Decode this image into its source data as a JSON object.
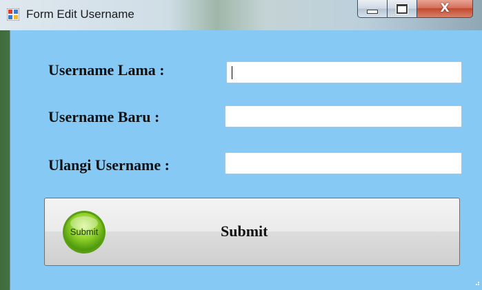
{
  "window": {
    "title": "Form Edit Username",
    "controls": {
      "minimize_icon": "minimize-icon",
      "maximize_icon": "maximize-icon",
      "close_icon": "close-icon",
      "close_glyph": "X"
    }
  },
  "form": {
    "fields": [
      {
        "label": "Username Lama :",
        "value": "",
        "focused": true
      },
      {
        "label": "Username Baru :",
        "value": ""
      },
      {
        "label": "Ulangi Username :",
        "value": ""
      }
    ],
    "submit": {
      "image_text": "Submit",
      "label": "Submit"
    }
  },
  "colors": {
    "client_background": "#87c9f5",
    "button_icon_green": "#7cc61e"
  }
}
